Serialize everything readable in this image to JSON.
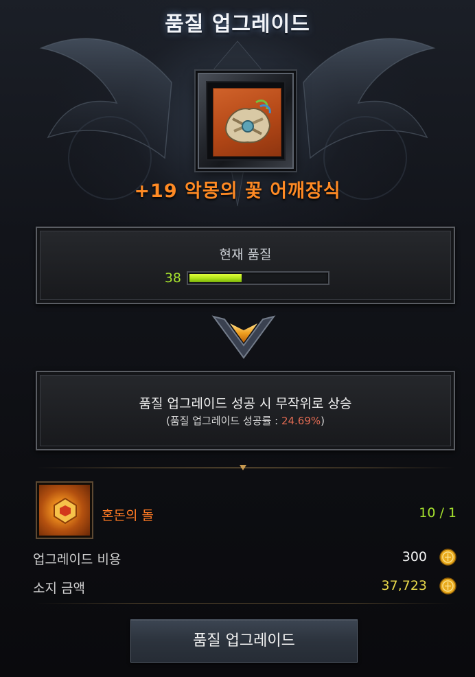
{
  "header": {
    "title": "품질 업그레이드"
  },
  "item": {
    "name": "+19 악몽의 꽃 어깨장식",
    "icon": "shoulder-armor-icon",
    "frame_color": "#c8561e"
  },
  "current_quality": {
    "label": "현재 품질",
    "value": "38",
    "fill_fraction": 0.38,
    "bar_color": "#b4e61a"
  },
  "info": {
    "main_text": "품질 업그레이드 성공 시 무작위로 상승",
    "sub_prefix": "(품질 업그레이드 성공률 : ",
    "success_rate": "24.69%",
    "sub_suffix": ")"
  },
  "material": {
    "name": "혼돈의 돌",
    "count": "10 / 1",
    "icon": "chaos-stone-icon"
  },
  "cost": {
    "label": "업그레이드 비용",
    "value": "300",
    "icon": "gold-coin-icon"
  },
  "owned": {
    "label": "소지 금액",
    "value": "37,723",
    "icon": "gold-coin-icon"
  },
  "actions": {
    "upgrade_label": "품질 업그레이드"
  },
  "colors": {
    "item_name": "#ff8a24",
    "quality_value": "#a6e22e",
    "success_rate": "#e06a52",
    "material_name": "#ff7a24",
    "owned_value": "#e8d84a"
  }
}
